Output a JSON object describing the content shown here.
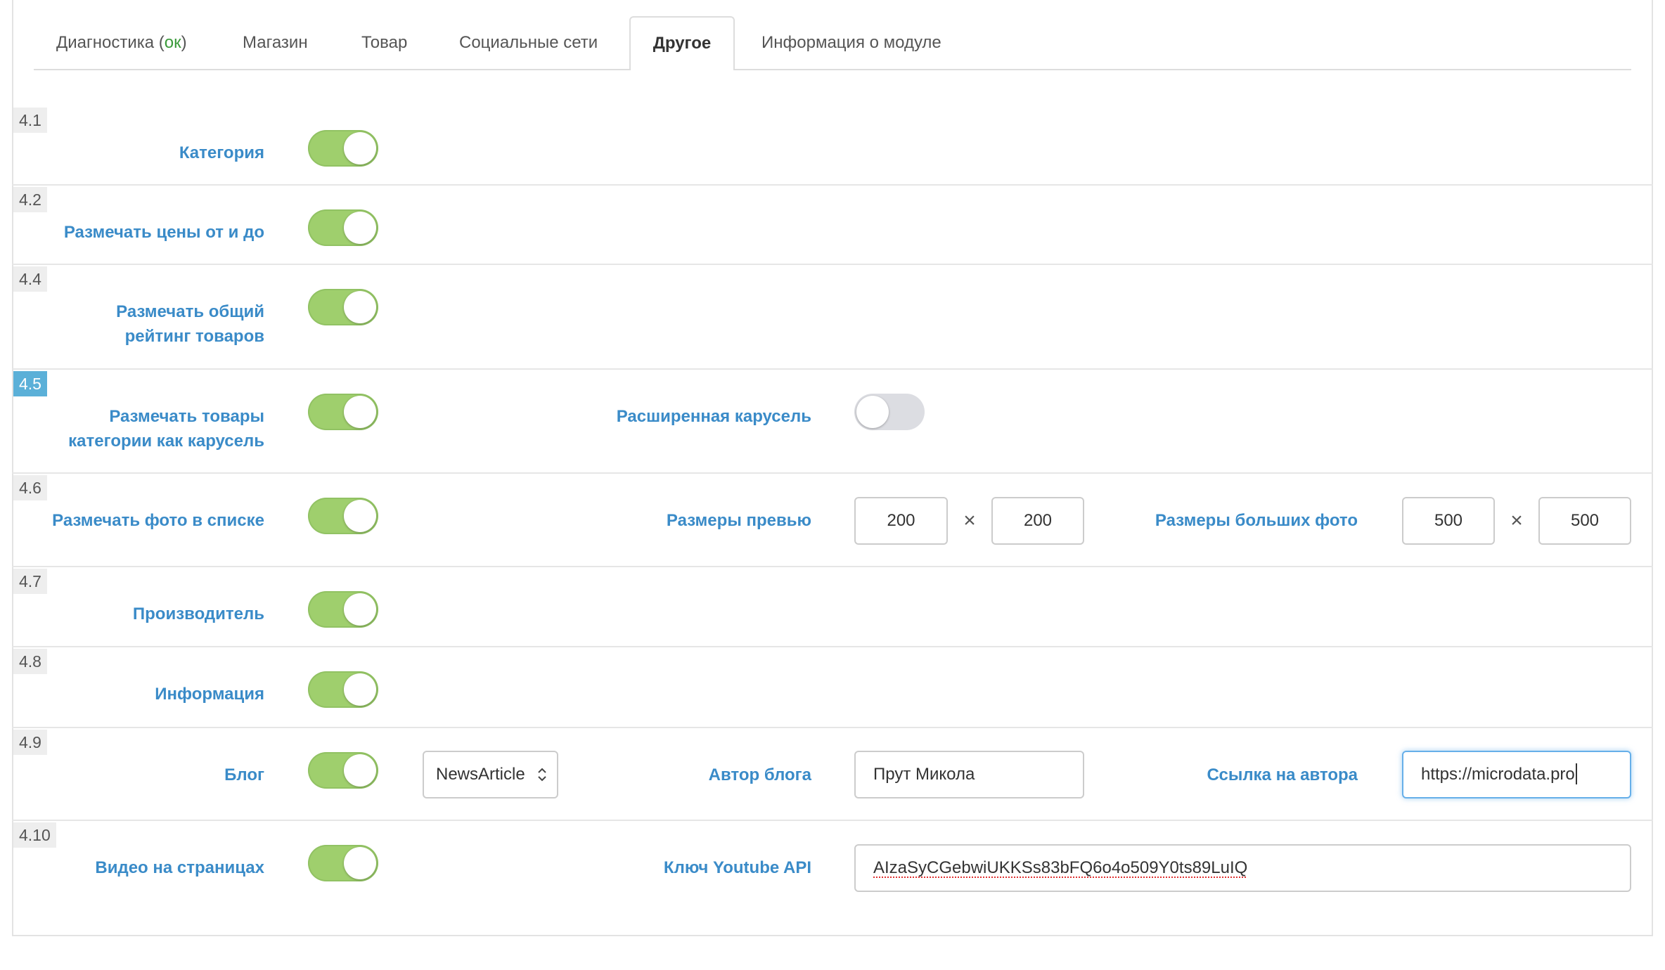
{
  "colors": {
    "label": "#3a8bc8",
    "toggle_on": "#9fcf6d",
    "toggle_off": "#dcdde2",
    "status_ok": "#3a9a3a",
    "badge_highlight": "#5bb0d8",
    "focus": "#66afe9"
  },
  "tabs": [
    {
      "label": "Диагностика (",
      "status": "ок",
      "suffix": ")",
      "active": false
    },
    {
      "label": "Магазин",
      "active": false
    },
    {
      "label": "Товар",
      "active": false
    },
    {
      "label": "Социальные сети",
      "active": false
    },
    {
      "label": "Другое",
      "active": true
    },
    {
      "label": "Информация о модуле",
      "active": false
    }
  ],
  "rows": [
    {
      "num": "4.1",
      "label": [
        "Категория"
      ],
      "enabled": true
    },
    {
      "num": "4.2",
      "label": [
        "Размечать цены от и до"
      ],
      "enabled": true
    },
    {
      "num": "4.4",
      "label": [
        "Размечать общий",
        "рейтинг товаров"
      ],
      "enabled": true
    },
    {
      "num": "4.5",
      "label": [
        "Размечать товары",
        "категории как карусель"
      ],
      "enabled": true,
      "highlighted": true,
      "extended_carousel": {
        "label": "Расширенная карусель",
        "enabled": false
      }
    },
    {
      "num": "4.6",
      "label": [
        "Размечать фото в списке"
      ],
      "enabled": true,
      "times": "×",
      "preview_size": {
        "label": "Размеры превью",
        "width": "200",
        "height": "200"
      },
      "large_size": {
        "label": "Размеры больших фото",
        "width": "500",
        "height": "500"
      }
    },
    {
      "num": "4.7",
      "label": [
        "Производитель"
      ],
      "enabled": true
    },
    {
      "num": "4.8",
      "label": [
        "Информация"
      ],
      "enabled": true
    },
    {
      "num": "4.9",
      "label": [
        "Блог"
      ],
      "enabled": true,
      "type_select": {
        "value": "NewsArticle",
        "icon": "chevron-up-down-icon"
      },
      "author": {
        "label": "Автор блога",
        "value": "Прут Микола"
      },
      "author_link": {
        "label": "Ссылка на автора",
        "value": "https://microdata.pro",
        "focused": true
      }
    },
    {
      "num": "4.10",
      "label": [
        "Видео на страницах"
      ],
      "enabled": true,
      "youtube_key": {
        "label": "Ключ Youtube API",
        "value": "AIzaSyCGebwiUKKSs83bFQ6o4o509Y0ts89LuIQ",
        "spellcheck_flagged": true
      }
    }
  ]
}
